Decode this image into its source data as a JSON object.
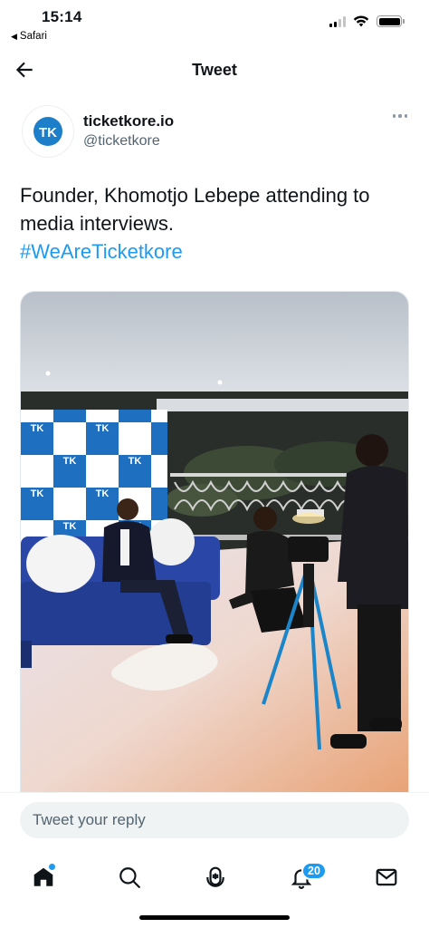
{
  "status_bar": {
    "time": "15:14",
    "back_app": "Safari"
  },
  "header": {
    "title": "Tweet"
  },
  "tweet": {
    "author_name": "ticketkore.io",
    "author_handle": "@ticketkore",
    "avatar_monogram": "TK",
    "text": "Founder, Khomotjo Lebepe attending to media interviews.",
    "hashtag": "#WeAreTicketkore",
    "media_backdrop_logo": "TK"
  },
  "reply": {
    "placeholder": "Tweet your reply"
  },
  "tabbar": {
    "notifications_count": "20"
  },
  "colors": {
    "accent": "#1d9bf0",
    "secondary_text": "#536471",
    "sofa": "#2a47a8",
    "backdrop_blue": "#1f6fc0"
  },
  "icons": {
    "back": "arrow-left-icon",
    "more": "more-horizontal-icon",
    "home": "home-icon",
    "search": "search-icon",
    "spaces": "spaces-microphone-icon",
    "notifications": "bell-icon",
    "messages": "envelope-icon"
  }
}
